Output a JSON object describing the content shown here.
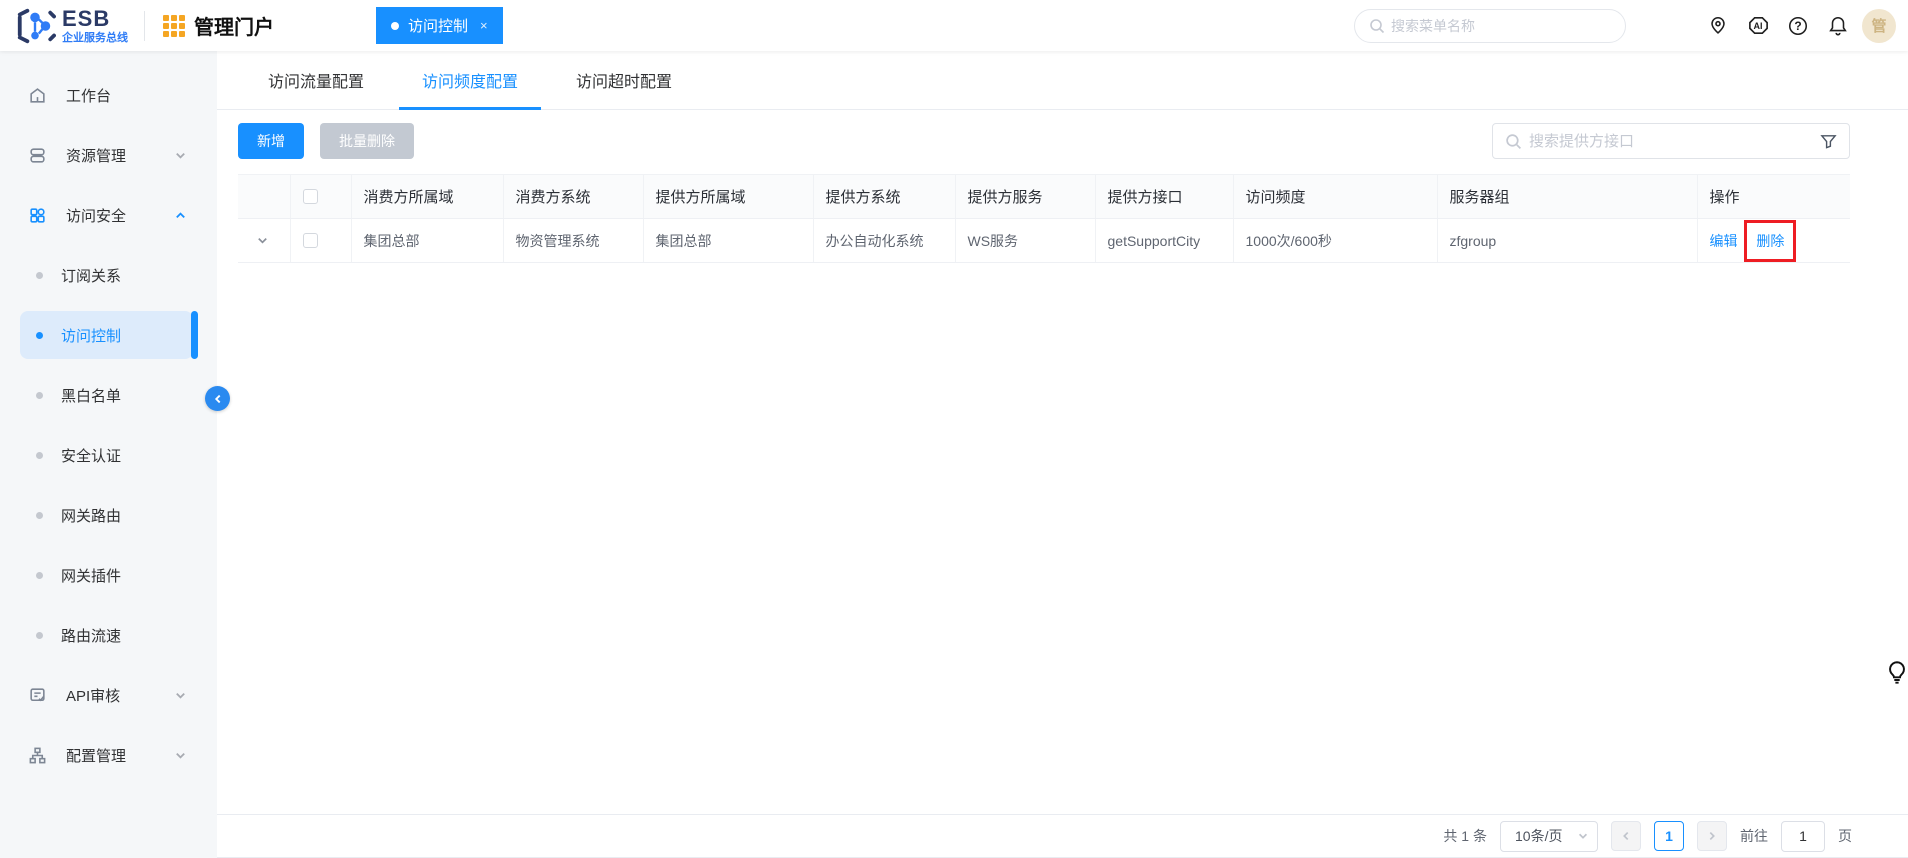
{
  "colors": {
    "accent": "#1890ff",
    "annotation_red": "#ee1d23",
    "portal_icon_orange": "#f5a623",
    "sidebar_bg": "#f5f7f9",
    "active_item_bg": "#ddebfb"
  },
  "header": {
    "logo_title": "ESB",
    "logo_subtitle": "企业服务总线",
    "portal_title": "管理门户",
    "tab_label": "访问控制",
    "tab_close": "×",
    "menu_search_placeholder": "搜索菜单名称",
    "ai_label": "AI",
    "help_label": "?",
    "avatar_text": "管"
  },
  "sidebar": {
    "items": [
      {
        "label": "工作台",
        "icon": "home-icon"
      },
      {
        "label": "资源管理",
        "icon": "resource-icon",
        "chevron": "down"
      },
      {
        "label": "访问安全",
        "icon": "apps-icon",
        "chevron": "up",
        "active": true
      },
      {
        "label": "订阅关系",
        "type": "sub"
      },
      {
        "label": "访问控制",
        "type": "sub",
        "active": true
      },
      {
        "label": "黑白名单",
        "type": "sub"
      },
      {
        "label": "安全认证",
        "type": "sub"
      },
      {
        "label": "网关路由",
        "type": "sub"
      },
      {
        "label": "网关插件",
        "type": "sub"
      },
      {
        "label": "路由流速",
        "type": "sub"
      },
      {
        "label": "API审核",
        "icon": "doc-icon",
        "chevron": "down"
      },
      {
        "label": "配置管理",
        "icon": "org-icon",
        "chevron": "down"
      }
    ]
  },
  "main": {
    "tabs": [
      {
        "label": "访问流量配置",
        "active": false
      },
      {
        "label": "访问频度配置",
        "active": true
      },
      {
        "label": "访问超时配置",
        "active": false
      }
    ],
    "toolbar": {
      "add_label": "新增",
      "batch_delete_label": "批量删除",
      "search_placeholder": "搜索提供方接口"
    },
    "table": {
      "headers": [
        "消费方所属域",
        "消费方系统",
        "提供方所属域",
        "提供方系统",
        "提供方服务",
        "提供方接口",
        "访问频度",
        "服务器组",
        "操作"
      ],
      "rows": [
        {
          "consumer_domain": "集团总部",
          "consumer_system": "物资管理系统",
          "provider_domain": "集团总部",
          "provider_system": "办公自动化系统",
          "provider_service": "WS服务",
          "provider_interface": "getSupportCity",
          "frequency": "1000次/600秒",
          "server_group": "zfgroup",
          "actions": [
            "编辑",
            "删除"
          ]
        }
      ]
    },
    "pagination": {
      "total_label": "共 1 条",
      "page_size_label": "10条/页",
      "current_page": "1",
      "goto_label": "前往",
      "goto_value": "1",
      "page_suffix": "页"
    }
  }
}
